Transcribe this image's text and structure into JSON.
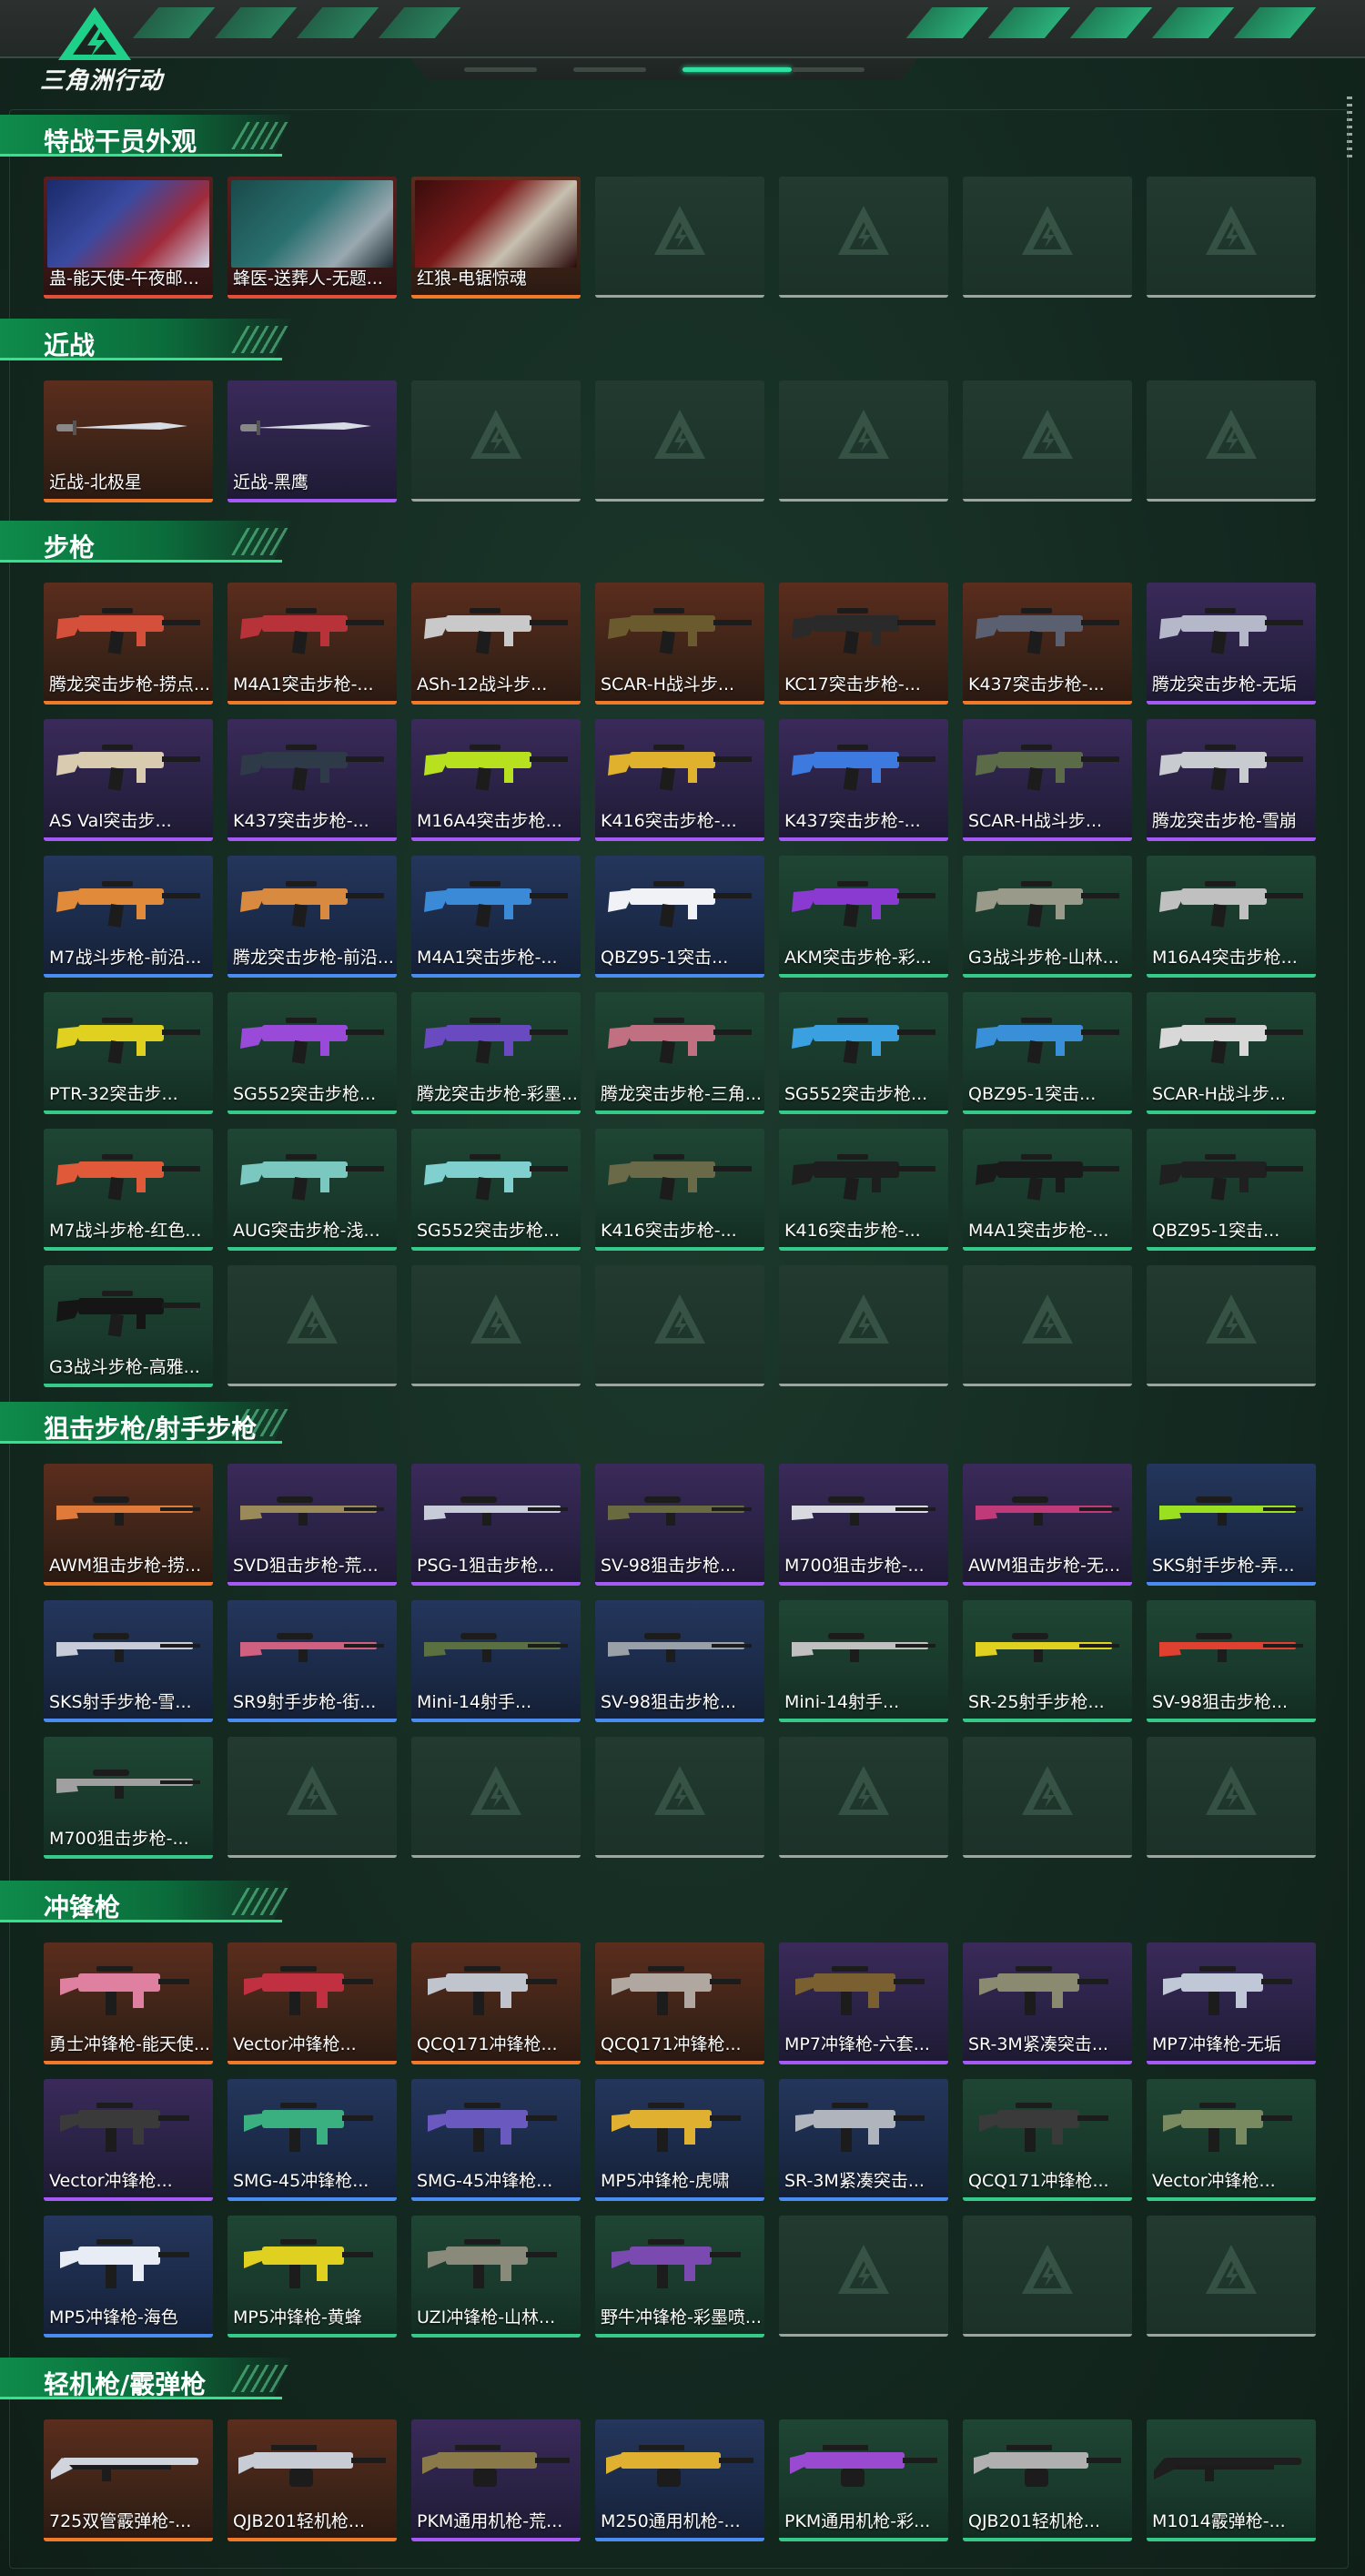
{
  "app": {
    "title": "三角洲行动"
  },
  "header": {
    "pager": [
      "",
      "",
      "",
      ""
    ],
    "active_page": 2
  },
  "sections": [
    {
      "title": "特战干员外观",
      "items": [
        {
          "label": "蛊-能天使-午夜邮...",
          "rarity": "red",
          "kind": "operator"
        },
        {
          "label": "蜂医-送葬人-无题...",
          "rarity": "red",
          "kind": "operator"
        },
        {
          "label": "红狼-电锯惊魂",
          "rarity": "orange",
          "kind": "operator"
        },
        null,
        null,
        null,
        null
      ]
    },
    {
      "title": "近战",
      "items": [
        {
          "label": "近战-北极星",
          "rarity": "orange",
          "kind": "knife"
        },
        {
          "label": "近战-黑鹰",
          "rarity": "purple",
          "kind": "knife"
        },
        null,
        null,
        null,
        null,
        null
      ]
    },
    {
      "title": "步枪",
      "items": [
        {
          "label": "腾龙突击步枪-捞点...",
          "rarity": "orange",
          "kind": "rifle",
          "color": "#d4503a"
        },
        {
          "label": "M4A1突击步枪-...",
          "rarity": "orange",
          "kind": "rifle",
          "color": "#b8323a"
        },
        {
          "label": "ASh-12战斗步...",
          "rarity": "orange",
          "kind": "rifle",
          "color": "#c9c9c9"
        },
        {
          "label": "SCAR-H战斗步...",
          "rarity": "orange",
          "kind": "rifle",
          "color": "#6b5a2e"
        },
        {
          "label": "KC17突击步枪-...",
          "rarity": "orange",
          "kind": "rifle",
          "color": "#2a2a2a"
        },
        {
          "label": "K437突击步枪-...",
          "rarity": "orange",
          "kind": "rifle",
          "color": "#5a6070"
        },
        {
          "label": "腾龙突击步枪-无垢",
          "rarity": "purple",
          "kind": "rifle",
          "color": "#b5b8c8"
        },
        {
          "label": "AS Val突击步...",
          "rarity": "purple",
          "kind": "rifle",
          "color": "#d8cbb0"
        },
        {
          "label": "K437突击步枪-...",
          "rarity": "purple",
          "kind": "rifle",
          "color": "#2f3a48"
        },
        {
          "label": "M16A4突击步枪...",
          "rarity": "purple",
          "kind": "rifle",
          "color": "#b7e01f"
        },
        {
          "label": "K416突击步枪-...",
          "rarity": "purple",
          "kind": "rifle",
          "color": "#e0b12c"
        },
        {
          "label": "K437突击步枪-...",
          "rarity": "purple",
          "kind": "rifle",
          "color": "#3d7ae0"
        },
        {
          "label": "SCAR-H战斗步...",
          "rarity": "purple",
          "kind": "rifle",
          "color": "#5b6b48"
        },
        {
          "label": "腾龙突击步枪-雪崩",
          "rarity": "purple",
          "kind": "rifle",
          "color": "#c8ccd0"
        },
        {
          "label": "M7战斗步枪-前沿...",
          "rarity": "blue",
          "kind": "rifle",
          "color": "#e08a3a"
        },
        {
          "label": "腾龙突击步枪-前沿...",
          "rarity": "blue",
          "kind": "rifle",
          "color": "#d88a40"
        },
        {
          "label": "M4A1突击步枪-...",
          "rarity": "blue",
          "kind": "rifle",
          "color": "#3a8ad8"
        },
        {
          "label": "QBZ95-1突击...",
          "rarity": "blue",
          "kind": "rifle",
          "color": "#f0f2f5"
        },
        {
          "label": "AKM突击步枪-彩...",
          "rarity": "green",
          "kind": "rifle",
          "color": "#8a3ad0"
        },
        {
          "label": "G3战斗步枪-山林...",
          "rarity": "green",
          "kind": "rifle",
          "color": "#9a9a8a"
        },
        {
          "label": "M16A4突击步枪...",
          "rarity": "green",
          "kind": "rifle",
          "color": "#c0c0c0"
        },
        {
          "label": "PTR-32突击步...",
          "rarity": "green",
          "kind": "rifle",
          "color": "#e0d020"
        },
        {
          "label": "SG552突击步枪...",
          "rarity": "green",
          "kind": "rifle",
          "color": "#9a4ad8"
        },
        {
          "label": "腾龙突击步枪-彩墨...",
          "rarity": "green",
          "kind": "rifle",
          "color": "#6a4ac0"
        },
        {
          "label": "腾龙突击步枪-三角...",
          "rarity": "green",
          "kind": "rifle",
          "color": "#c07080"
        },
        {
          "label": "SG552突击步枪...",
          "rarity": "green",
          "kind": "rifle",
          "color": "#3aa0e0"
        },
        {
          "label": "QBZ95-1突击...",
          "rarity": "green",
          "kind": "rifle",
          "color": "#3a90d8"
        },
        {
          "label": "SCAR-H战斗步...",
          "rarity": "green",
          "kind": "rifle",
          "color": "#d8d8d8"
        },
        {
          "label": "M7战斗步枪-红色...",
          "rarity": "green",
          "kind": "rifle",
          "color": "#e05a3a"
        },
        {
          "label": "AUG突击步枪-浅...",
          "rarity": "green",
          "kind": "rifle",
          "color": "#7ac8c0"
        },
        {
          "label": "SG552突击步枪...",
          "rarity": "green",
          "kind": "rifle",
          "color": "#80d0d0"
        },
        {
          "label": "K416突击步枪-...",
          "rarity": "green",
          "kind": "rifle",
          "color": "#6a6a48"
        },
        {
          "label": "K416突击步枪-...",
          "rarity": "green",
          "kind": "rifle",
          "color": "#1e1e1e"
        },
        {
          "label": "M4A1突击步枪-...",
          "rarity": "green",
          "kind": "rifle",
          "color": "#1a1a1a"
        },
        {
          "label": "QBZ95-1突击...",
          "rarity": "green",
          "kind": "rifle",
          "color": "#202020"
        },
        {
          "label": "G3战斗步枪-高雅...",
          "rarity": "green",
          "kind": "rifle",
          "color": "#151515"
        },
        null,
        null,
        null,
        null,
        null,
        null
      ]
    },
    {
      "title": "狙击步枪/射手步枪",
      "items": [
        {
          "label": "AWM狙击步枪-捞...",
          "rarity": "orange",
          "kind": "sniper",
          "color": "#e07a3a"
        },
        {
          "label": "SVD狙击步枪-荒...",
          "rarity": "purple",
          "kind": "sniper",
          "color": "#9a8a5a"
        },
        {
          "label": "PSG-1狙击步枪...",
          "rarity": "purple",
          "kind": "sniper",
          "color": "#c8ccd8"
        },
        {
          "label": "SV-98狙击步枪...",
          "rarity": "purple",
          "kind": "sniper",
          "color": "#6a6a40"
        },
        {
          "label": "M700狙击步枪-...",
          "rarity": "purple",
          "kind": "sniper",
          "color": "#d8d8e0"
        },
        {
          "label": "AWM狙击步枪-无...",
          "rarity": "purple",
          "kind": "sniper",
          "color": "#c03a7a"
        },
        {
          "label": "SKS射手步枪-弄...",
          "rarity": "blue",
          "kind": "sniper",
          "color": "#9ae020"
        },
        {
          "label": "SKS射手步枪-雪...",
          "rarity": "blue",
          "kind": "sniper",
          "color": "#c8ccd8"
        },
        {
          "label": "SR9射手步枪-街...",
          "rarity": "blue",
          "kind": "sniper",
          "color": "#d06080"
        },
        {
          "label": "Mini-14射手...",
          "rarity": "blue",
          "kind": "sniper",
          "color": "#5a7040"
        },
        {
          "label": "SV-98狙击步枪...",
          "rarity": "blue",
          "kind": "sniper",
          "color": "#9aa0a8"
        },
        {
          "label": "Mini-14射手...",
          "rarity": "green",
          "kind": "sniper",
          "color": "#c0c0c0"
        },
        {
          "label": "SR-25射手步枪...",
          "rarity": "green",
          "kind": "sniper",
          "color": "#e0d020"
        },
        {
          "label": "SV-98狙击步枪...",
          "rarity": "green",
          "kind": "sniper",
          "color": "#e04030"
        },
        {
          "label": "M700狙击步枪-...",
          "rarity": "green",
          "kind": "sniper",
          "color": "#a0a0a0"
        },
        null,
        null,
        null,
        null,
        null,
        null
      ]
    },
    {
      "title": "冲锋枪",
      "items": [
        {
          "label": "勇士冲锋枪-能天使...",
          "rarity": "orange",
          "kind": "smg",
          "color": "#e080a0"
        },
        {
          "label": "Vector冲锋枪...",
          "rarity": "orange",
          "kind": "smg",
          "color": "#c03040"
        },
        {
          "label": "QCQ171冲锋枪...",
          "rarity": "orange",
          "kind": "smg",
          "color": "#c0c4cc"
        },
        {
          "label": "QCQ171冲锋枪...",
          "rarity": "orange",
          "kind": "smg",
          "color": "#b0a8a0"
        },
        {
          "label": "MP7冲锋枪-六套...",
          "rarity": "purple",
          "kind": "smg",
          "color": "#7a6030"
        },
        {
          "label": "SR-3M紧凑突击...",
          "rarity": "purple",
          "kind": "smg",
          "color": "#8a8a70"
        },
        {
          "label": "MP7冲锋枪-无垢",
          "rarity": "purple",
          "kind": "smg",
          "color": "#c0c8d8"
        },
        {
          "label": "Vector冲锋枪...",
          "rarity": "purple",
          "kind": "smg",
          "color": "#3a3a3a"
        },
        {
          "label": "SMG-45冲锋枪...",
          "rarity": "blue",
          "kind": "smg",
          "color": "#3ab080"
        },
        {
          "label": "SMG-45冲锋枪...",
          "rarity": "blue",
          "kind": "smg",
          "color": "#6a5ac0"
        },
        {
          "label": "MP5冲锋枪-虎啸",
          "rarity": "blue",
          "kind": "smg",
          "color": "#e0b030"
        },
        {
          "label": "SR-3M紧凑突击...",
          "rarity": "blue",
          "kind": "smg",
          "color": "#b0b4bc"
        },
        {
          "label": "QCQ171冲锋枪...",
          "rarity": "green",
          "kind": "smg",
          "color": "#3a3a3a"
        },
        {
          "label": "Vector冲锋枪...",
          "rarity": "green",
          "kind": "smg",
          "color": "#7a8a60"
        },
        {
          "label": "MP5冲锋枪-海色",
          "rarity": "blue",
          "kind": "smg",
          "color": "#e8ecf4"
        },
        {
          "label": "MP5冲锋枪-黄蜂",
          "rarity": "green",
          "kind": "smg",
          "color": "#e0d020"
        },
        {
          "label": "UZI冲锋枪-山林...",
          "rarity": "green",
          "kind": "smg",
          "color": "#8a8a7a"
        },
        {
          "label": "野牛冲锋枪-彩墨喷...",
          "rarity": "green",
          "kind": "smg",
          "color": "#7a4ab0"
        },
        null,
        null,
        null
      ]
    },
    {
      "title": "轻机枪/霰弹枪",
      "items": [
        {
          "label": "725双管霰弹枪-...",
          "rarity": "orange",
          "kind": "shotgun",
          "color": "#d0d4dc"
        },
        {
          "label": "QJB201轻机枪...",
          "rarity": "orange",
          "kind": "lmg",
          "color": "#c8ccd4"
        },
        {
          "label": "PKM通用机枪-荒...",
          "rarity": "purple",
          "kind": "lmg",
          "color": "#8a7a4a"
        },
        {
          "label": "M250通用机枪-...",
          "rarity": "blue",
          "kind": "lmg",
          "color": "#e0b030"
        },
        {
          "label": "PKM通用机枪-彩...",
          "rarity": "green",
          "kind": "lmg",
          "color": "#9a4ad0"
        },
        {
          "label": "QJB201轻机枪...",
          "rarity": "green",
          "kind": "lmg",
          "color": "#b0b0b0"
        },
        {
          "label": "M1014霰弹枪-...",
          "rarity": "green",
          "kind": "shotgun",
          "color": "#1e1e1e"
        }
      ]
    }
  ]
}
